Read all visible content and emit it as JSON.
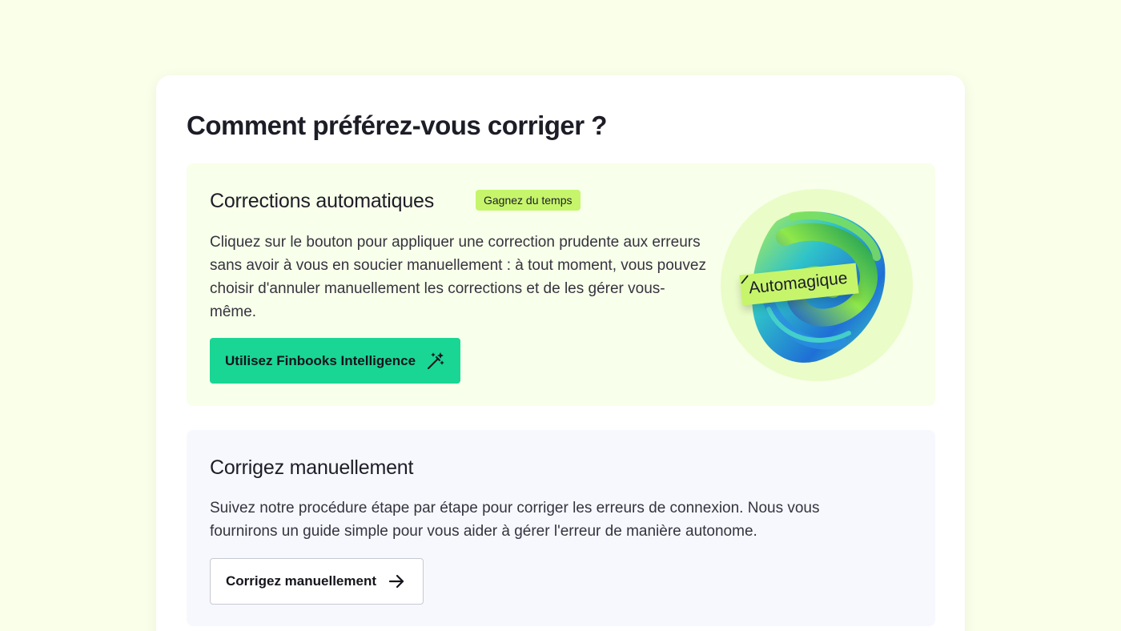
{
  "page": {
    "title": "Comment préférez-vous corriger ?"
  },
  "auto": {
    "title": "Corrections automatiques",
    "badge": "Gagnez du temps",
    "description": "Cliquez sur le bouton pour appliquer une correction prudente aux erreurs sans avoir à vous en soucier manuellement : à tout moment, vous pouvez choisir d'annuler manuellement les corrections et de les gérer vous-même.",
    "button_label": "Utilisez Finbooks Intelligence",
    "button_icon": "magic-wand-icon",
    "illustration_label": "Automagique",
    "illustration_icon": "pencil-icon"
  },
  "manual": {
    "title": "Corrigez manuellement",
    "description": "Suivez notre procédure étape par étape pour corriger les erreurs de connexion. Nous vous fournirons un guide simple pour vous aider à gérer l'erreur de manière autonome.",
    "button_label": "Corrigez manuellement",
    "button_icon": "arrow-right-icon"
  },
  "colors": {
    "page_background": "#f9ffe9",
    "auto_panel": "#f8ffea",
    "manual_panel": "#f7f8fe",
    "primary_button": "#19d694",
    "badge": "#c6f56c",
    "illustration_circle": "#eafcc8"
  }
}
